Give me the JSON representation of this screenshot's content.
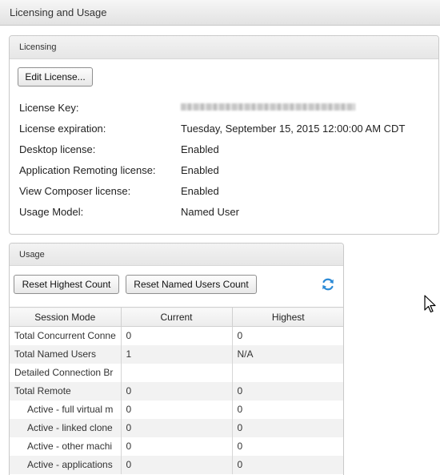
{
  "page": {
    "title": "Licensing and Usage"
  },
  "licensing": {
    "heading": "Licensing",
    "edit_button": "Edit License...",
    "rows": [
      {
        "label": "License Key:",
        "value": ""
      },
      {
        "label": "License expiration:",
        "value": "Tuesday, September 15, 2015 12:00:00 AM CDT"
      },
      {
        "label": "Desktop license:",
        "value": "Enabled"
      },
      {
        "label": "Application Remoting license:",
        "value": "Enabled"
      },
      {
        "label": "View Composer license:",
        "value": "Enabled"
      },
      {
        "label": "Usage Model:",
        "value": "Named User"
      }
    ]
  },
  "usage": {
    "heading": "Usage",
    "reset_highest": "Reset Highest Count",
    "reset_named": "Reset Named Users Count",
    "columns": [
      "Session Mode",
      "Current",
      "Highest"
    ],
    "rows": [
      {
        "mode": "Total Concurrent Conne",
        "current": "0",
        "highest": "0"
      },
      {
        "mode": "Total Named Users",
        "current": "1",
        "highest": "N/A"
      },
      {
        "mode": "Detailed Connection Br",
        "current": "",
        "highest": ""
      },
      {
        "mode": "Total Remote",
        "current": "0",
        "highest": "0"
      },
      {
        "mode": "Active - full virtual m",
        "current": "0",
        "highest": "0"
      },
      {
        "mode": "Active - linked clone",
        "current": "0",
        "highest": "0"
      },
      {
        "mode": "Active - other machi",
        "current": "0",
        "highest": "0"
      },
      {
        "mode": "Active - applications",
        "current": "0",
        "highest": "0"
      }
    ]
  },
  "icons": {
    "refresh": "refresh-icon",
    "cursor": "mouse-pointer-icon"
  },
  "colors": {
    "refresh_icon": "#2b8ad6"
  }
}
